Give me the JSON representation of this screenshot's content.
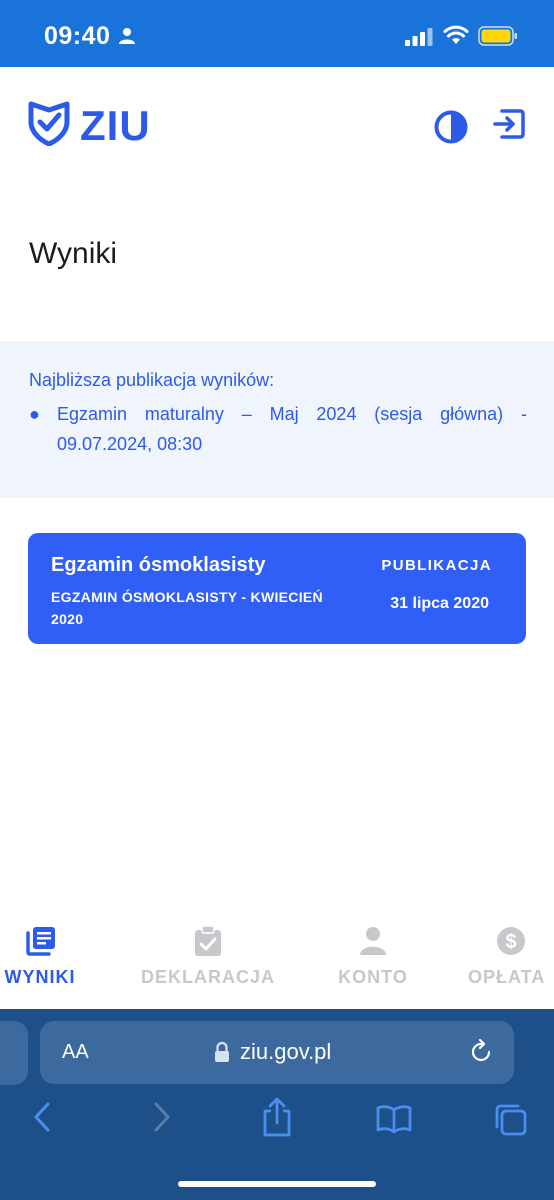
{
  "status_bar": {
    "time": "09:40"
  },
  "header": {
    "logo_text": "ZIU"
  },
  "page": {
    "title": "Wyniki"
  },
  "info": {
    "heading": "Najbliższa publikacja wyników:",
    "items": [
      "Egzamin maturalny – Maj 2024 (sesja główna) - 09.07.2024, 08:30"
    ]
  },
  "exam_card": {
    "title": "Egzamin ósmoklasisty",
    "subtitle": "EGZAMIN ÓSMOKLASISTY - KWIECIEŃ 2020",
    "publication_label": "PUBLIKACJA",
    "publication_date": "31 lipca 2020"
  },
  "tabs": [
    {
      "label": "WYNIKI",
      "icon": "results-icon",
      "active": true
    },
    {
      "label": "DEKLARACJA",
      "icon": "clipboard-check-icon",
      "active": false
    },
    {
      "label": "KONTO",
      "icon": "person-icon",
      "active": false
    },
    {
      "label": "OPŁATA",
      "icon": "dollar-coin-icon",
      "active": false
    }
  ],
  "browser": {
    "aa_label": "AA",
    "url": "ziu.gov.pl"
  },
  "colors": {
    "primary": "#2c5bea",
    "card": "#2f5ff7",
    "status_bar": "#1a73d9",
    "info_bg": "#f0f4fc",
    "safari_bg": "#1d4f88"
  }
}
